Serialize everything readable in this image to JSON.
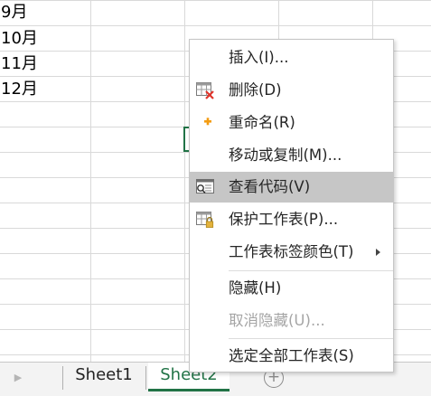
{
  "cells": [
    "9月",
    "10月",
    "11月",
    "12月"
  ],
  "sheet_tabs": [
    {
      "label": "Sheet1",
      "active": false
    },
    {
      "label": "Sheet2",
      "active": true
    }
  ],
  "add_sheet_symbol": "+",
  "context_menu": {
    "items": [
      {
        "label": "插入(I)...",
        "icon": "none",
        "enabled": true
      },
      {
        "label": "删除(D)",
        "icon": "delete-sheet-icon",
        "enabled": true
      },
      {
        "label": "重命名(R)",
        "icon": "rename-icon",
        "enabled": true
      },
      {
        "label": "移动或复制(M)...",
        "icon": "none",
        "enabled": true
      },
      {
        "label": "查看代码(V)",
        "icon": "view-code-icon",
        "enabled": true,
        "highlighted": true
      },
      {
        "label": "保护工作表(P)...",
        "icon": "protect-sheet-icon",
        "enabled": true
      },
      {
        "label": "工作表标签颜色(T)",
        "icon": "none",
        "enabled": true,
        "submenu": true
      },
      {
        "label": "隐藏(H)",
        "icon": "none",
        "enabled": true
      },
      {
        "label": "取消隐藏(U)...",
        "icon": "none",
        "enabled": false
      },
      {
        "label": "选定全部工作表(S)",
        "icon": "none",
        "enabled": true
      }
    ]
  },
  "colors": {
    "accent_green": "#217346",
    "menu_highlight": "#c6c6c6",
    "delete_red": "#e0352b",
    "rename_orange": "#f39c12",
    "lock_gold": "#e3b23c"
  }
}
